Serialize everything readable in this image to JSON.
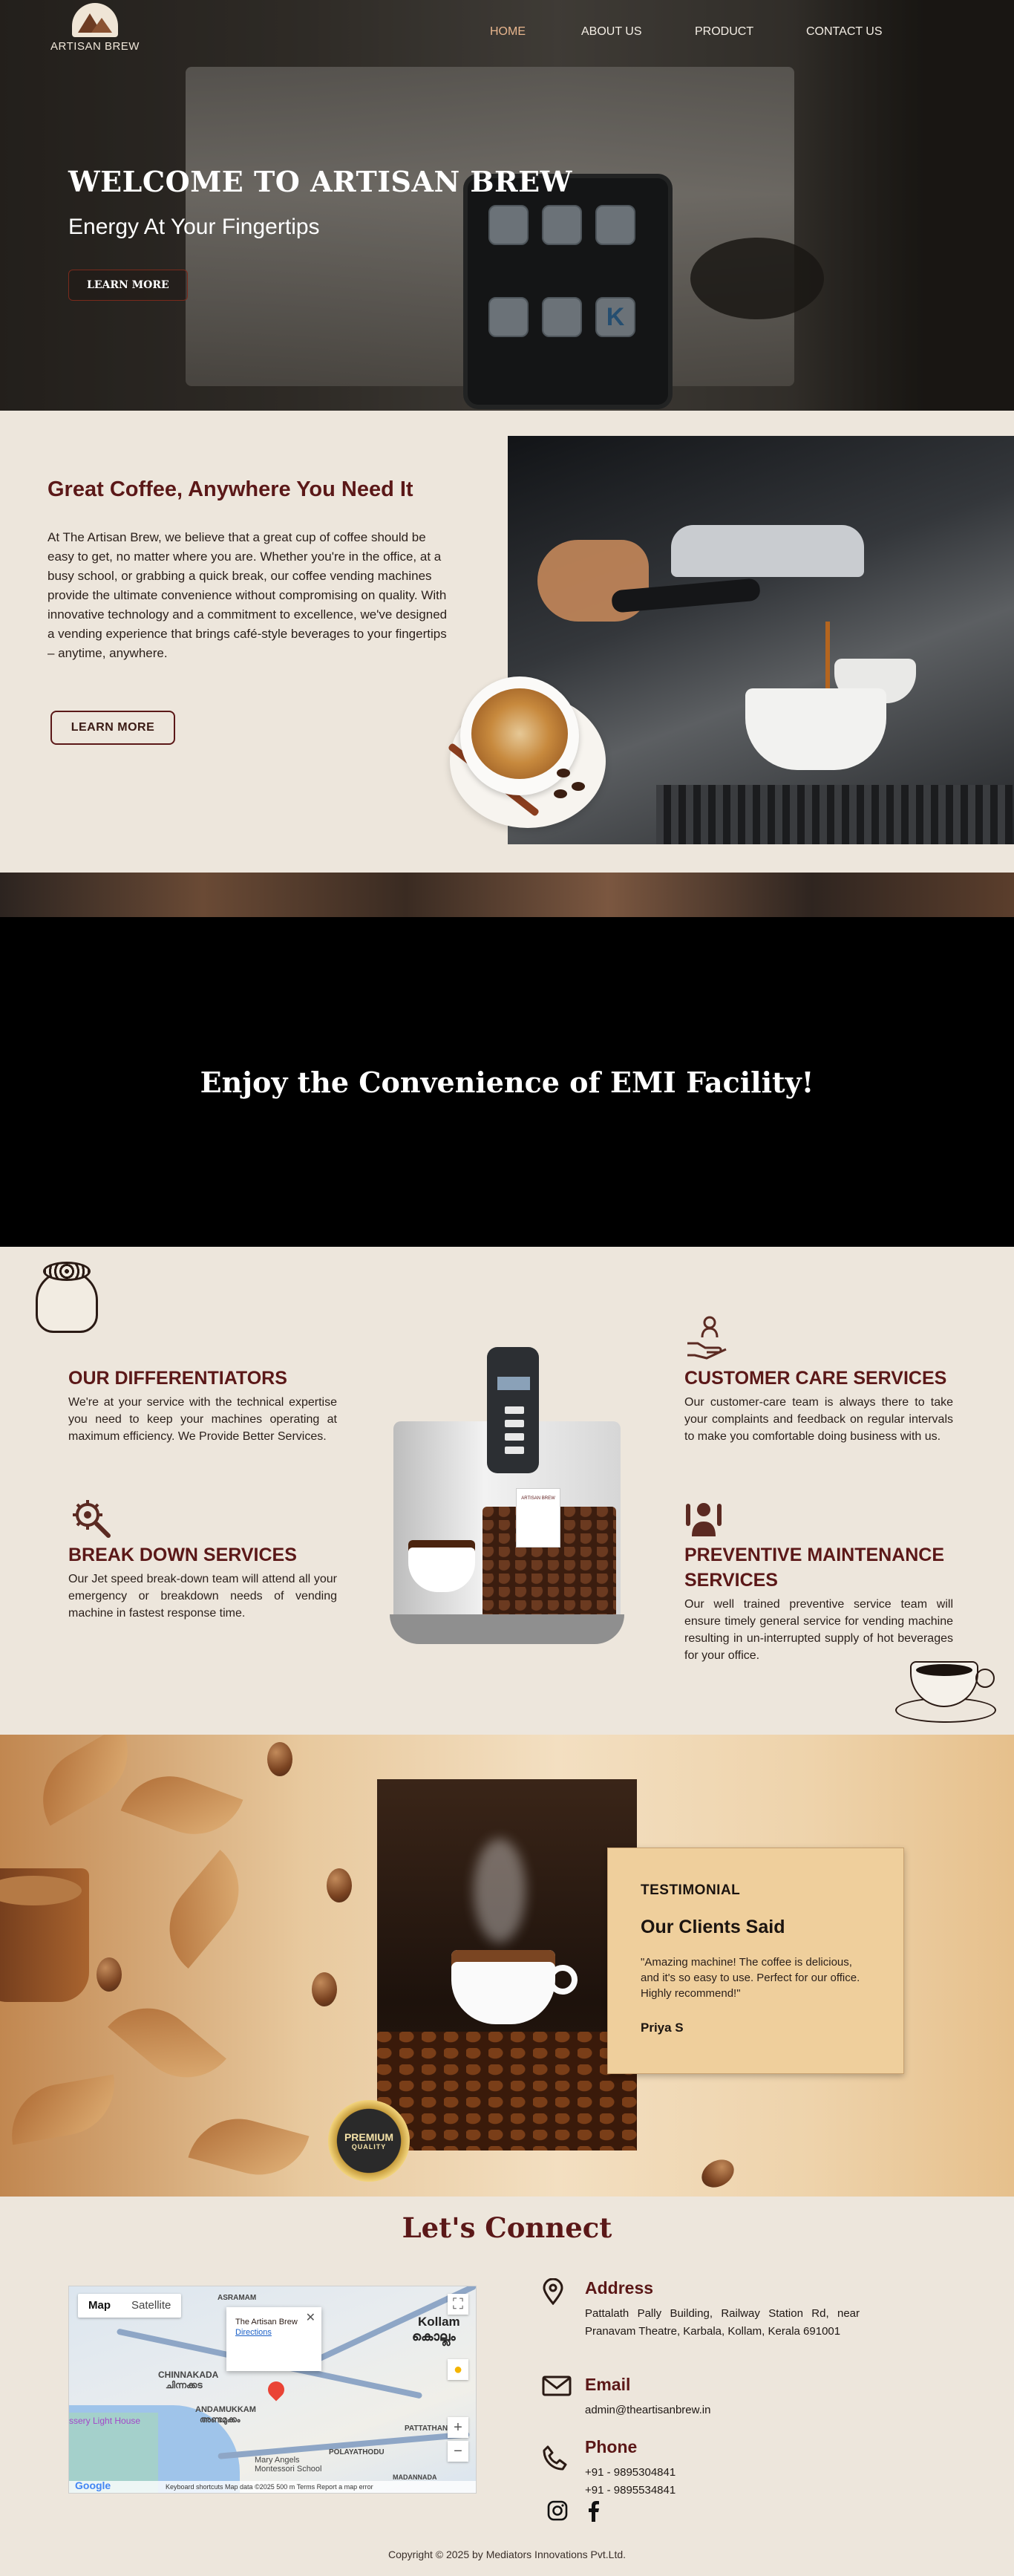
{
  "brand": {
    "name": "ARTISAN BREW"
  },
  "nav": {
    "items": [
      "HOME",
      "ABOUT US",
      "PRODUCT",
      "CONTACT US"
    ],
    "active": "HOME"
  },
  "hero": {
    "title": "WELCOME TO ARTISAN BREW",
    "subtitle": "Energy At Your Fingertips",
    "button": "LEARN MORE",
    "panel_letter": "K"
  },
  "about": {
    "heading": "Great Coffee, Anywhere You Need It",
    "body": "At The Artisan Brew, we believe that a great cup of coffee should be easy to get, no matter where you are. Whether you're in the office, at a busy school, or grabbing a quick break, our coffee vending machines provide the ultimate convenience without compromising on quality. With innovative technology and a commitment to excellence, we've designed a vending experience that brings café-style beverages to your fingertips – anytime, anywhere.",
    "button": "LEARN MORE"
  },
  "emi": {
    "heading": "Enjoy the Convenience of EMI Facility!"
  },
  "services": [
    {
      "title": "OUR DIFFERENTIATORS",
      "text": "We're at your service with the technical expertise you need to keep your machines operating at maximum efficiency. We Provide Better Services.",
      "icon": "coffee-sack-icon"
    },
    {
      "title": "BREAK DOWN SERVICES",
      "text": "Our Jet speed break-down team will attend all your emergency or breakdown needs of vending machine in fastest response time.",
      "icon": "gear-wrench-icon"
    },
    {
      "title": "CUSTOMER CARE SERVICES",
      "text": "Our customer-care team is always there to take your complaints and feedback on regular intervals to make you comfortable doing business with us.",
      "icon": "hand-person-icon"
    },
    {
      "title": "PREVENTIVE MAINTENANCE SERVICES",
      "text": "Our well trained preventive service team will ensure timely general service for vending machine resulting in un-interrupted supply of hot beverages for your office.",
      "icon": "person-tools-icon"
    }
  ],
  "machine_label": "ARTISAN BREW",
  "badge": {
    "line1": "PREMIUM",
    "line2": "QUALITY"
  },
  "testimonial": {
    "tag": "TESTIMONIAL",
    "heading": "Our Clients Said",
    "quote": "\"Amazing machine! The coffee is delicious, and it's so easy to use. Perfect for our office. Highly recommend!\"",
    "author": "Priya S"
  },
  "contact": {
    "heading": "Let's Connect",
    "map": {
      "tab_map": "Map",
      "tab_satellite": "Satellite",
      "popup_title": "The Artisan Brew",
      "popup_link": "Directions",
      "labels": [
        "ASRAMAM",
        "CHINNAKADA",
        "ചിന്നക്കട",
        "ANDAMUKKAM",
        "അണ്ടമുക്കം",
        "Kollam",
        "കൊല്ലം",
        "PATTATHANAM",
        "POLAYATHODU",
        "Mary Angels Montessori School",
        "ssery Light House",
        "MADANNADA"
      ],
      "footer": "Keyboard shortcuts   Map data ©2025   500 m   Terms   Report a map error",
      "google": "Google"
    },
    "address": {
      "title": "Address",
      "text": "Pattalath Pally Building, Railway Station Rd, near Pranavam Theatre, Karbala, Kollam, Kerala 691001"
    },
    "email": {
      "title": "Email",
      "text": "admin@theartisanbrew.in"
    },
    "phone": {
      "title": "Phone",
      "lines": [
        "+91 - 9895304841",
        "+91 - 9895534841"
      ]
    }
  },
  "footer": {
    "copyright": "Copyright © 2025 by Mediators Innovations Pvt.Ltd."
  }
}
